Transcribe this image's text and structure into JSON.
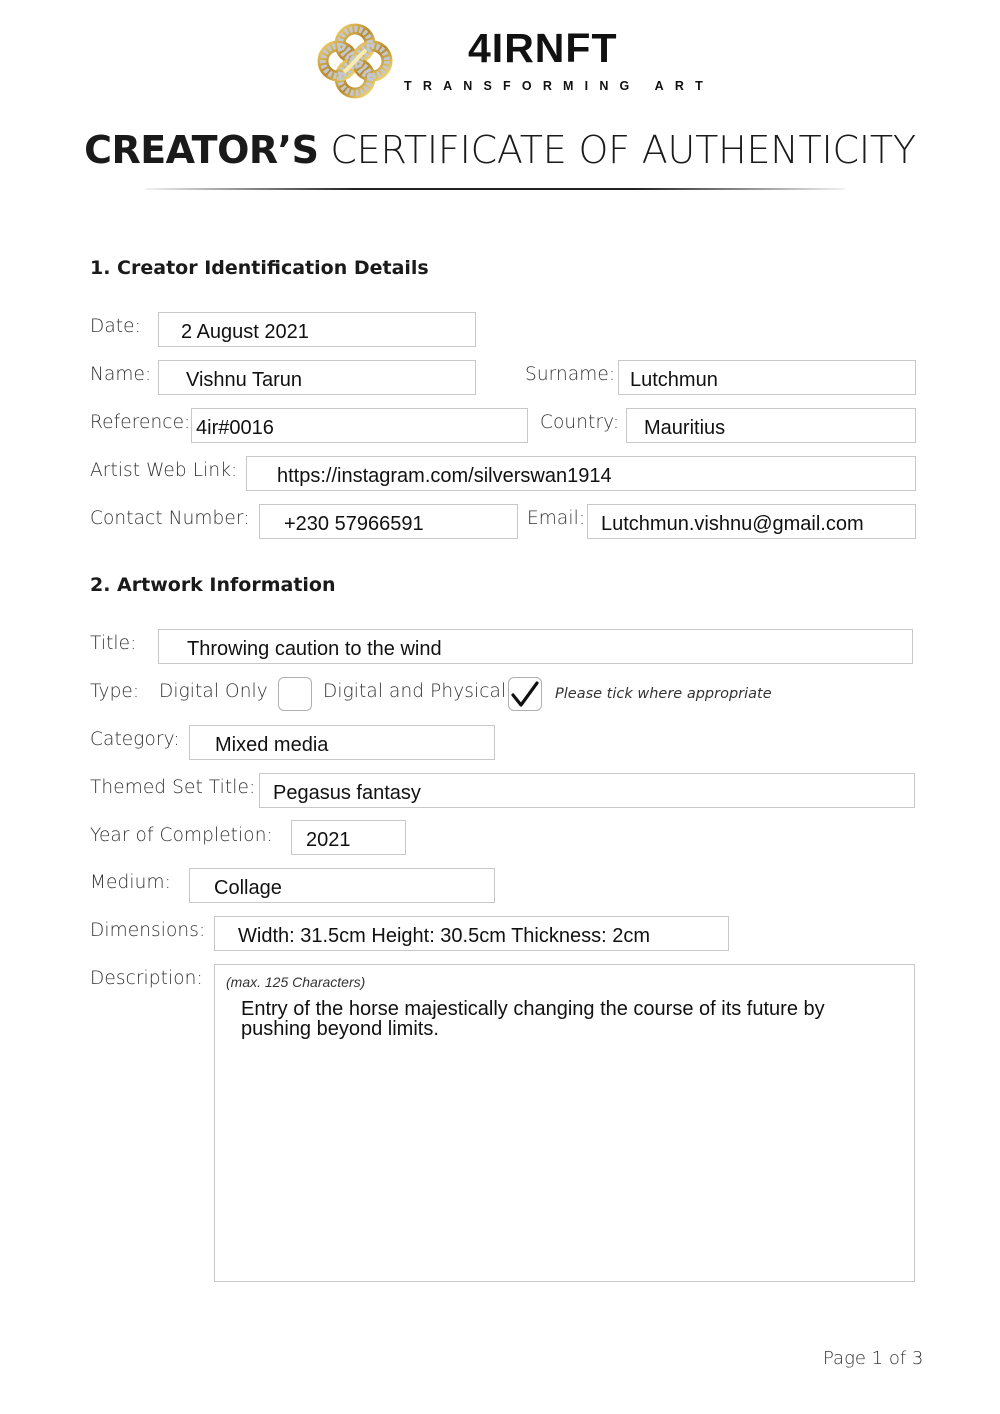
{
  "header": {
    "brand_name": "4IRNFT",
    "tagline": "TRANSFORMING ART",
    "logo_icon": "gold-infinity-knot-logo",
    "title_bold": "CREATOR’S",
    "title_light": " CERTIFICATE OF AUTHENTICITY"
  },
  "section1": {
    "heading": "1. Creator Identification Details",
    "date": {
      "label": "Date:",
      "value": "2 August 2021"
    },
    "name": {
      "label": "Name:",
      "value": "Vishnu Tarun"
    },
    "surname": {
      "label": "Surname:",
      "value": "Lutchmun"
    },
    "reference": {
      "label": "Reference:",
      "value": "4ir#0016"
    },
    "country": {
      "label": "Country:",
      "value": "Mauritius"
    },
    "web_link": {
      "label": "Artist Web Link:",
      "value": "https://instagram.com/silverswan1914"
    },
    "contact": {
      "label": "Contact Number:",
      "value": "+230 57966591"
    },
    "email": {
      "label": "Email:",
      "value": "Lutchmun.vishnu@gmail.com"
    }
  },
  "section2": {
    "heading": "2. Artwork Information",
    "title": {
      "label": "Title:",
      "value": "Throwing caution to the wind"
    },
    "type": {
      "label": "Type:",
      "options": [
        {
          "label": "Digital Only",
          "checked": false
        },
        {
          "label": "Digital and Physical",
          "checked": true
        }
      ],
      "hint": "Please tick where appropriate",
      "check_glyph": "✓"
    },
    "category": {
      "label": "Category:",
      "value": "Mixed media"
    },
    "themed_set": {
      "label": "Themed Set Title:",
      "value": "Pegasus fantasy"
    },
    "year": {
      "label": "Year of Completion:",
      "value": "2021"
    },
    "medium": {
      "label": "Medium:",
      "value": "Collage"
    },
    "dimensions": {
      "label": "Dimensions:",
      "value": "Width: 31.5cm Height: 30.5cm Thickness: 2cm"
    },
    "description": {
      "label": "Description:",
      "hint": "(max. 125 Characters)",
      "value": "Entry of the horse majestically changing the course of its future by pushing beyond limits."
    }
  },
  "footer": {
    "page_label": "Page 1 of 3"
  },
  "colors": {
    "logo_gold": "#c9a23a",
    "logo_silver": "#b8bcc4",
    "field_border": "#c8c8c8"
  }
}
